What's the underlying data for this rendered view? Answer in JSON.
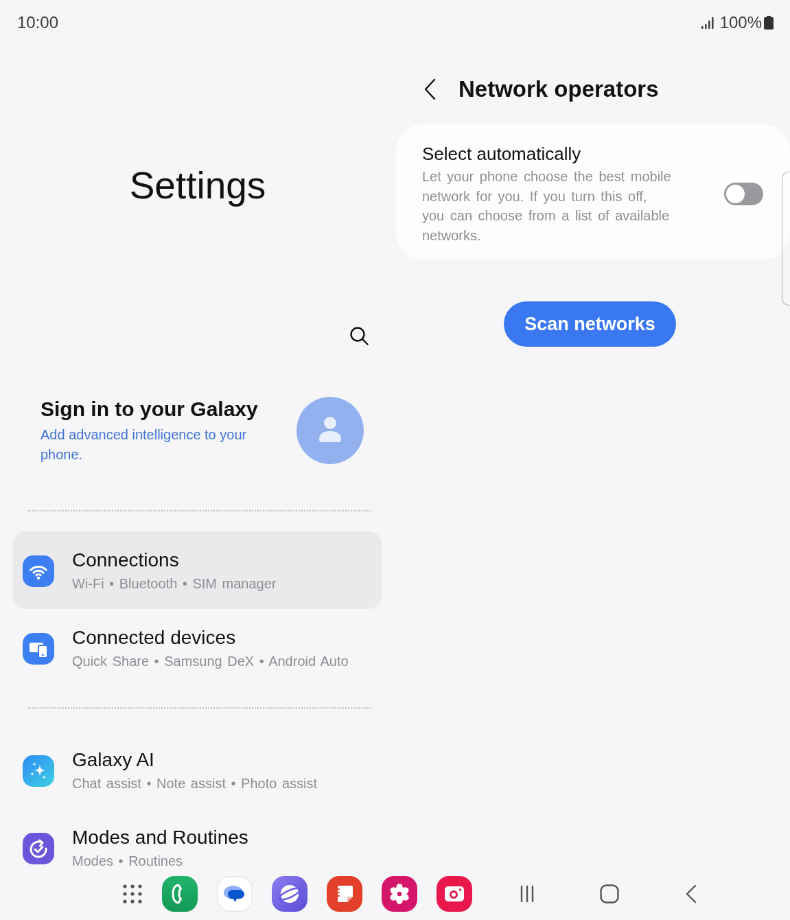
{
  "status_bar": {
    "time": "10:00",
    "battery": "100%"
  },
  "settings_panel": {
    "title": "Settings",
    "account": {
      "title": "Sign in to your Galaxy",
      "subtitle": "Add advanced intelligence to your phone."
    },
    "groups": [
      {
        "items": [
          {
            "title": "Connections",
            "subtitle": "Wi-Fi • Bluetooth • SIM manager",
            "selected": true
          },
          {
            "title": "Connected devices",
            "subtitle": "Quick Share • Samsung DeX • Android Auto",
            "selected": false
          }
        ]
      },
      {
        "items": [
          {
            "title": "Galaxy AI",
            "subtitle": "Chat assist • Note assist • Photo assist",
            "selected": false
          },
          {
            "title": "Modes and Routines",
            "subtitle": "Modes • Routines",
            "selected": false
          }
        ]
      }
    ]
  },
  "detail_panel": {
    "title": "Network operators",
    "auto_select": {
      "title": "Select automatically",
      "description": "Let your phone choose the best mobile network for you. If you turn this off, you can choose from a list of available networks.",
      "on": false
    },
    "scan_button": "Scan networks"
  }
}
